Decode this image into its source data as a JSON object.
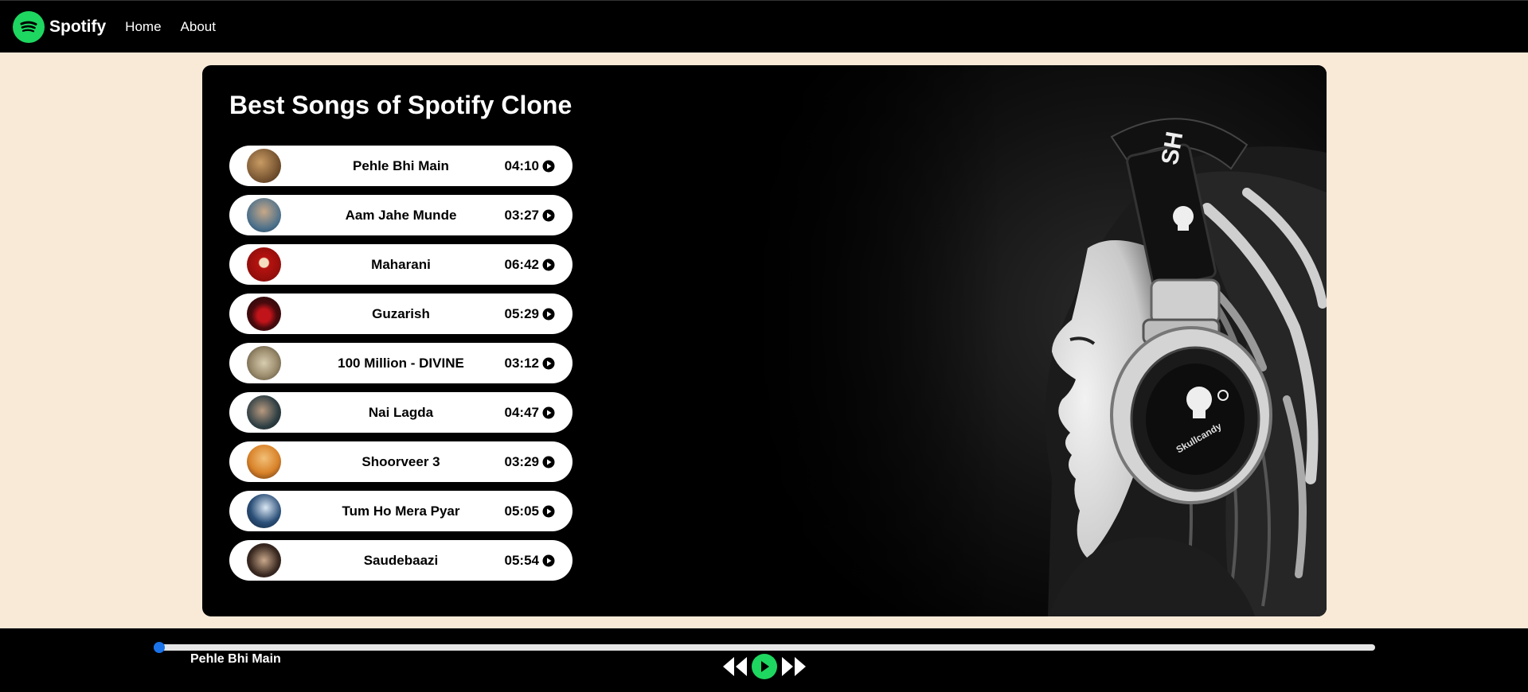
{
  "navbar": {
    "brand": "Spotify",
    "links": [
      "Home",
      "About"
    ],
    "logo_color": "#1ed760"
  },
  "main": {
    "title": "Best Songs of Spotify Clone",
    "songs": [
      {
        "name": "Pehle Bhi Main",
        "duration": "04:10",
        "cover_color": "#6b4a2a"
      },
      {
        "name": "Aam Jahe Munde",
        "duration": "03:27",
        "cover_color": "#4a6f8a"
      },
      {
        "name": "Maharani",
        "duration": "06:42",
        "cover_color": "#b5130f"
      },
      {
        "name": "Guzarish",
        "duration": "05:29",
        "cover_color": "#1c0b0b"
      },
      {
        "name": "100 Million - DIVINE",
        "duration": "03:12",
        "cover_color": "#9a8b6c"
      },
      {
        "name": "Nai Lagda",
        "duration": "04:47",
        "cover_color": "#2f3f44"
      },
      {
        "name": "Shoorveer 3",
        "duration": "03:29",
        "cover_color": "#d9832a"
      },
      {
        "name": "Tum Ho Mera Pyar",
        "duration": "05:05",
        "cover_color": "#2b4f78"
      },
      {
        "name": "Saudebaazi",
        "duration": "05:54",
        "cover_color": "#3b2a22"
      }
    ]
  },
  "player": {
    "now_playing": "Pehle Bhi Main",
    "progress": 0,
    "accent": "#1ed760",
    "thumb_color": "#1a73e8"
  }
}
